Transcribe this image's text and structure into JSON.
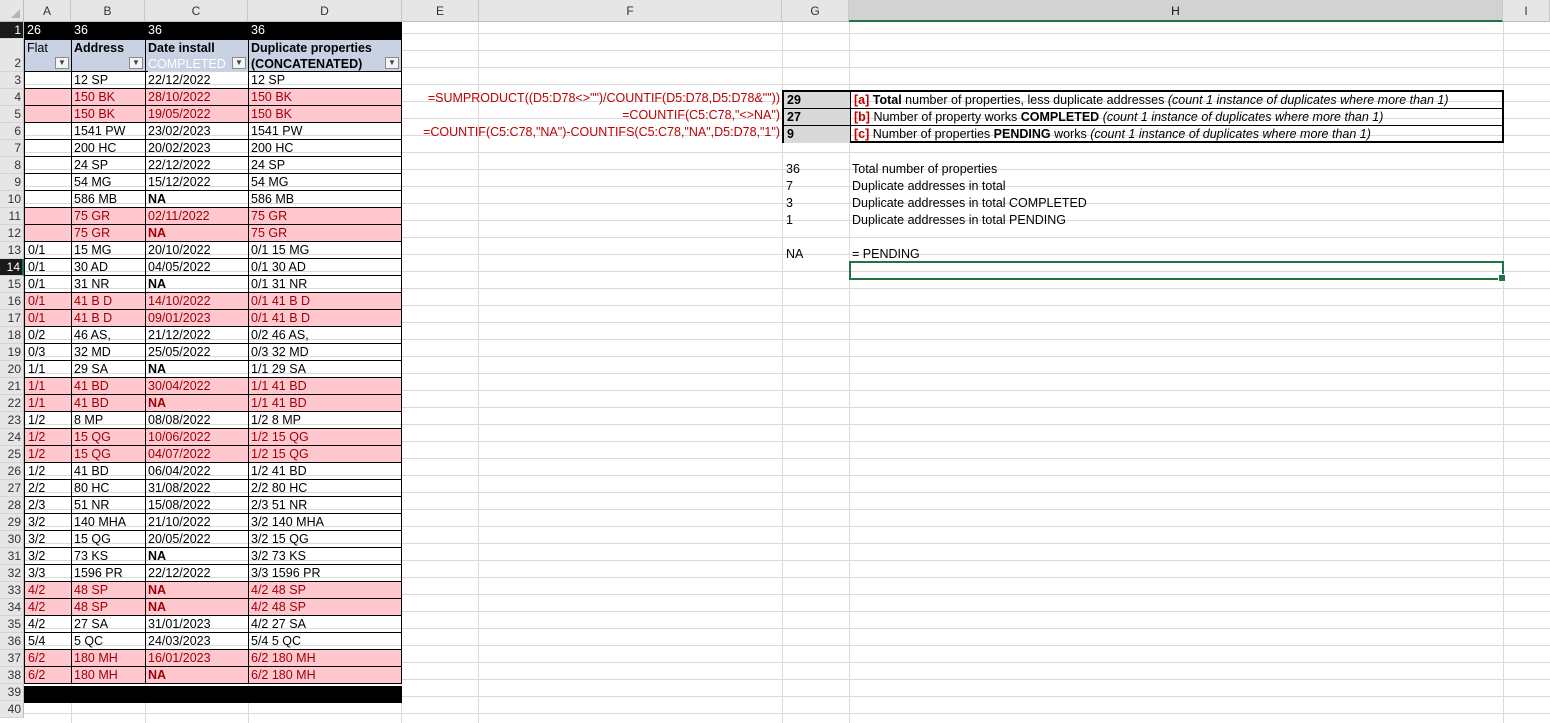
{
  "columns": [
    "A",
    "B",
    "C",
    "D",
    "E",
    "F",
    "G",
    "H",
    "I"
  ],
  "selected_column": "H",
  "row_numbers": [
    "1",
    "2",
    "3",
    "4",
    "5",
    "6",
    "7",
    "8",
    "9",
    "10",
    "11",
    "12",
    "13",
    "14",
    "15",
    "16",
    "17",
    "18",
    "19",
    "20",
    "21",
    "22",
    "23",
    "24",
    "25",
    "26",
    "27",
    "28",
    "29",
    "30",
    "31",
    "32",
    "33",
    "34",
    "35",
    "36",
    "37",
    "38",
    "39",
    "40"
  ],
  "selected_row": "14",
  "row1": {
    "a": "26",
    "b": "36",
    "c": "36",
    "d": "36"
  },
  "headers": {
    "flat": "Flat",
    "address": "Address",
    "date_line1": "Date install",
    "date_line2": "COMPLETED",
    "dup_line1": "Duplicate properties",
    "dup_line2": "(CONCATENATED)",
    "filter_icon": "filter-dropdown-icon"
  },
  "colors": {
    "pink_fill": "#ffc7ce",
    "pink_text": "#9c0006",
    "formula_red": "#c00000",
    "header_fill": "#c9d2e3",
    "select_green": "#217346"
  },
  "rows": [
    {
      "flat": "",
      "address": "12 SP",
      "date": "22/12/2022",
      "dup": " 12 SP",
      "pink": false,
      "na": false
    },
    {
      "flat": "",
      "address": "150 BK",
      "date": "28/10/2022",
      "dup": " 150 BK",
      "pink": true,
      "na": false
    },
    {
      "flat": "",
      "address": "150 BK",
      "date": "19/05/2022",
      "dup": " 150 BK",
      "pink": true,
      "na": false
    },
    {
      "flat": "",
      "address": "1541 PW",
      "date": "23/02/2023",
      "dup": " 1541 PW",
      "pink": false,
      "na": false
    },
    {
      "flat": "",
      "address": "200 HC",
      "date": "20/02/2023",
      "dup": " 200 HC",
      "pink": false,
      "na": false
    },
    {
      "flat": "",
      "address": "24 SP",
      "date": "22/12/2022",
      "dup": " 24 SP",
      "pink": false,
      "na": false
    },
    {
      "flat": "",
      "address": "54 MG",
      "date": "15/12/2022",
      "dup": " 54 MG",
      "pink": false,
      "na": false
    },
    {
      "flat": "",
      "address": "586 MB",
      "date": "NA",
      "dup": " 586 MB",
      "pink": false,
      "na": true
    },
    {
      "flat": "",
      "address": "75 GR",
      "date": "02/11/2022",
      "dup": " 75 GR",
      "pink": true,
      "na": false
    },
    {
      "flat": "",
      "address": "75 GR",
      "date": "NA",
      "dup": " 75 GR",
      "pink": true,
      "na": true
    },
    {
      "flat": "0/1",
      "address": "15 MG",
      "date": "20/10/2022",
      "dup": "0/1 15 MG",
      "pink": false,
      "na": false
    },
    {
      "flat": "0/1",
      "address": "30 AD",
      "date": "04/05/2022",
      "dup": "0/1 30 AD",
      "pink": false,
      "na": false
    },
    {
      "flat": "0/1",
      "address": "31 NR",
      "date": "NA",
      "dup": "0/1 31 NR",
      "pink": false,
      "na": true
    },
    {
      "flat": "0/1",
      "address": "41 B D",
      "date": "14/10/2022",
      "dup": "0/1 41 B D",
      "pink": true,
      "na": false
    },
    {
      "flat": "0/1",
      "address": "41 B D",
      "date": "09/01/2023",
      "dup": "0/1 41 B D",
      "pink": true,
      "na": false
    },
    {
      "flat": "0/2",
      "address": "46 AS,",
      "date": "21/12/2022",
      "dup": "0/2 46 AS,",
      "pink": false,
      "na": false
    },
    {
      "flat": "0/3",
      "address": "32 MD",
      "date": "25/05/2022",
      "dup": "0/3 32 MD",
      "pink": false,
      "na": false
    },
    {
      "flat": "1/1",
      "address": "29 SA",
      "date": "NA",
      "dup": "1/1 29 SA",
      "pink": false,
      "na": true
    },
    {
      "flat": "1/1",
      "address": "41 BD",
      "date": "30/04/2022",
      "dup": "1/1 41 BD",
      "pink": true,
      "na": false
    },
    {
      "flat": "1/1",
      "address": "41 BD",
      "date": "NA",
      "dup": "1/1 41 BD",
      "pink": true,
      "na": true
    },
    {
      "flat": "1/2",
      "address": "8 MP",
      "date": "08/08/2022",
      "dup": "1/2  8 MP",
      "pink": false,
      "na": false
    },
    {
      "flat": "1/2",
      "address": "15 QG",
      "date": "10/06/2022",
      "dup": "1/2 15 QG",
      "pink": true,
      "na": false
    },
    {
      "flat": "1/2",
      "address": "15 QG",
      "date": "04/07/2022",
      "dup": "1/2 15 QG",
      "pink": true,
      "na": false
    },
    {
      "flat": "1/2",
      "address": "41 BD",
      "date": "06/04/2022",
      "dup": "1/2 41 BD",
      "pink": false,
      "na": false
    },
    {
      "flat": "2/2",
      "address": "80 HC",
      "date": "31/08/2022",
      "dup": "2/2 80 HC",
      "pink": false,
      "na": false
    },
    {
      "flat": "2/3",
      "address": "51 NR",
      "date": "15/08/2022",
      "dup": "2/3 51 NR",
      "pink": false,
      "na": false
    },
    {
      "flat": "3/2",
      "address": "140 MHA",
      "date": "21/10/2022",
      "dup": "3/2 140 MHA",
      "pink": false,
      "na": false
    },
    {
      "flat": "3/2",
      "address": "15 QG",
      "date": "20/05/2022",
      "dup": "3/2 15 QG",
      "pink": false,
      "na": false
    },
    {
      "flat": "3/2",
      "address": "73 KS",
      "date": "NA",
      "dup": "3/2 73 KS",
      "pink": false,
      "na": true
    },
    {
      "flat": "3/3",
      "address": "1596 PR",
      "date": "22/12/2022",
      "dup": "3/3 1596 PR",
      "pink": false,
      "na": false
    },
    {
      "flat": "4/2",
      "address": "48 SP",
      "date": "NA",
      "dup": "4/2  48 SP",
      "pink": true,
      "na": true
    },
    {
      "flat": "4/2",
      "address": "48 SP",
      "date": "NA",
      "dup": "4/2  48 SP",
      "pink": true,
      "na": true
    },
    {
      "flat": "4/2",
      "address": "27 SA",
      "date": "31/01/2023",
      "dup": "4/2 27 SA",
      "pink": false,
      "na": false
    },
    {
      "flat": "5/4",
      "address": "5 QC",
      "date": "24/03/2023",
      "dup": "5/4 5 QC",
      "pink": false,
      "na": false
    },
    {
      "flat": "6/2",
      "address": "180 MH",
      "date": "16/01/2023",
      "dup": "6/2 180 MH",
      "pink": true,
      "na": false
    },
    {
      "flat": "6/2",
      "address": "180 MH",
      "date": "NA",
      "dup": "6/2 180 MH",
      "pink": true,
      "na": true
    }
  ],
  "formulas": {
    "f4": "=SUMPRODUCT((D5:D78<>\"\")/COUNTIF(D5:D78,D5:D78&\"\"))",
    "f5": "=COUNTIF(C5:C78,\"<>NA\")",
    "f6": "=COUNTIF(C5:C78,\"NA\")-COUNTIFS(C5:C78,\"NA\",D5:D78,\"1\")"
  },
  "summary": [
    {
      "value": "29",
      "tag": "[a]",
      "bold_word": "Total",
      "before": "",
      "after": " number of properties, less duplicate addresses  ",
      "note": "(count 1 instance of duplicates where more than 1)"
    },
    {
      "value": "27",
      "tag": "[b]",
      "bold_word": "COMPLETED",
      "before": " Number of property works ",
      "after": " ",
      "note": "(count 1 instance of duplicates where more than 1)"
    },
    {
      "value": "9",
      "tag": "[c]",
      "bold_word": "PENDING",
      "before": " Number of properties ",
      "after": " works ",
      "note": "(count 1 instance of duplicates where more than 1)"
    }
  ],
  "stats": [
    {
      "value": "36",
      "label": "Total number of properties"
    },
    {
      "value": "7",
      "label": "Duplicate addresses in total"
    },
    {
      "value": "3",
      "label": "Duplicate addresses in total COMPLETED"
    },
    {
      "value": "1",
      "label": "Duplicate addresses in total PENDING"
    }
  ],
  "legend": {
    "key": "NA",
    "text": "= PENDING"
  }
}
